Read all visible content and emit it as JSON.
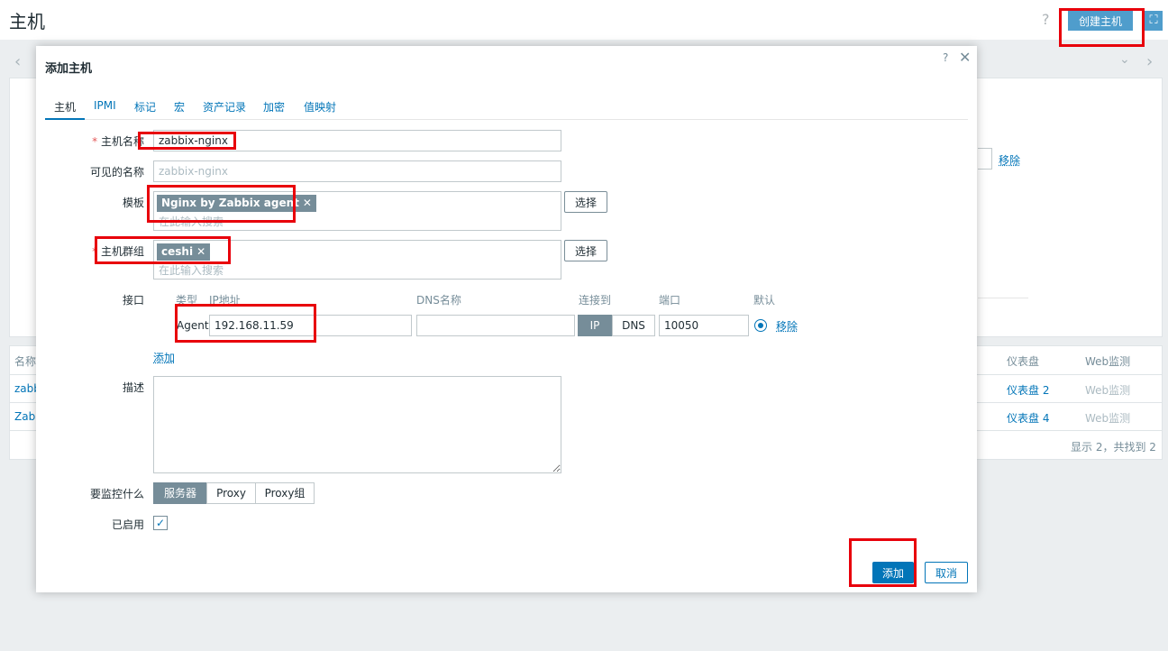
{
  "page": {
    "title": "主机",
    "help_icon": "?",
    "create_host_label": "创建主机",
    "fullscreen_icon": "⛶"
  },
  "background": {
    "remove_link": "移除",
    "table_headers": [
      "名称",
      "仪表盘",
      "Web监测"
    ],
    "rows": [
      {
        "name": "zabb",
        "dashboard": "仪表盘 2",
        "web": "Web监测"
      },
      {
        "name": "Zabb",
        "dashboard": "仪表盘 4",
        "web": "Web监测"
      }
    ],
    "footer": "显示 2，共找到 2"
  },
  "modal": {
    "title": "添加主机",
    "help": "?",
    "close": "✕",
    "tabs": [
      "主机",
      "IPMI",
      "标记",
      "宏",
      "资产记录",
      "加密",
      "值映射"
    ],
    "host_name": {
      "required_mark": "*",
      "label": "主机名称",
      "value": "zabbix-nginx"
    },
    "visible_name": {
      "label": "可见的名称",
      "placeholder": "zabbix-nginx"
    },
    "templates": {
      "label": "模板",
      "chips": [
        "Nginx by Zabbix agent"
      ],
      "placeholder": "在此输入搜索",
      "select_label": "选择"
    },
    "host_groups": {
      "required_mark": "*",
      "label": "主机群组",
      "chips": [
        "ceshi"
      ],
      "placeholder": "在此输入搜索",
      "select_label": "选择"
    },
    "interfaces": {
      "label": "接口",
      "headers": {
        "type": "类型",
        "ip": "IP地址",
        "dns": "DNS名称",
        "connect": "连接到",
        "port": "端口",
        "default": "默认"
      },
      "row": {
        "type": "Agent",
        "ip": "192.168.11.59",
        "dns": "",
        "connect_ip": "IP",
        "connect_dns": "DNS",
        "port": "10050",
        "remove": "移除"
      },
      "add_link": "添加"
    },
    "description": {
      "label": "描述",
      "value": ""
    },
    "monitored_by": {
      "label": "要监控什么",
      "options": [
        "服务器",
        "Proxy",
        "Proxy组"
      ],
      "selected": "服务器"
    },
    "enabled": {
      "label": "已启用",
      "checked": true
    },
    "buttons": {
      "add": "添加",
      "cancel": "取消"
    }
  },
  "colors": {
    "accent": "#0275b8",
    "annotation": "#e8000b",
    "chip": "#768d99"
  }
}
